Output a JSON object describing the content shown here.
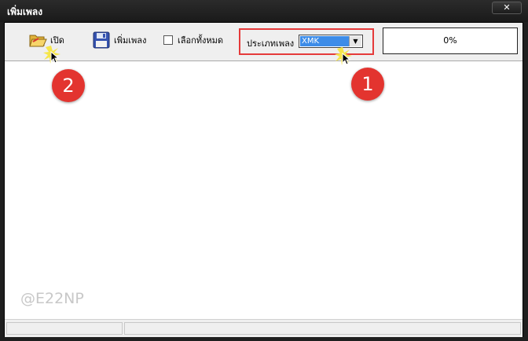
{
  "window": {
    "title": "เพิ่มเพลง",
    "close_glyph": "✕"
  },
  "toolbar": {
    "open_label": "เปิด",
    "add_label": "เพิ่มเพลง",
    "select_all_label": "เลือกทั้งหมด",
    "song_type_label": "ประเภทเพลง",
    "song_type_value": "XMK",
    "select_arrow": "▼"
  },
  "progress": {
    "text": "0%",
    "value": 0
  },
  "watermark": "@E22NP",
  "annotations": {
    "badge_1": "1",
    "badge_2": "2"
  },
  "colors": {
    "highlight_box": "#e53a3a",
    "badge": "#e3342f",
    "select_selected": "#3d8ce8"
  }
}
